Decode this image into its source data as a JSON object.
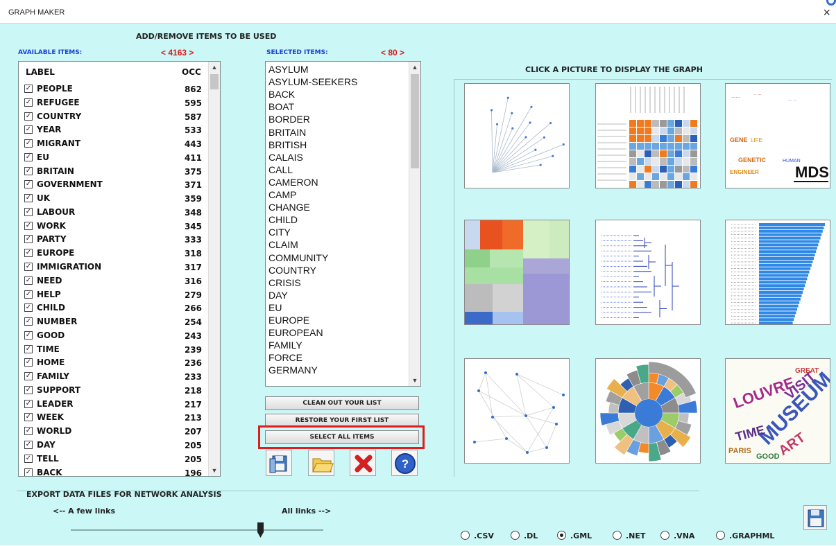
{
  "window": {
    "title": "GRAPH MAKER",
    "close": "×"
  },
  "header": {
    "add_remove": "ADD/REMOVE ITEMS TO BE USED",
    "click_picture": "CLICK A PICTURE TO DISPLAY THE GRAPH"
  },
  "available": {
    "title": "AVAILABLE ITEMS:",
    "count": "< 4163 >",
    "col_label": "LABEL",
    "col_occ": "OCC",
    "items": [
      {
        "label": "PEOPLE",
        "occ": "862"
      },
      {
        "label": "REFUGEE",
        "occ": "595"
      },
      {
        "label": "COUNTRY",
        "occ": "587"
      },
      {
        "label": "YEAR",
        "occ": "533"
      },
      {
        "label": "MIGRANT",
        "occ": "443"
      },
      {
        "label": "EU",
        "occ": "411"
      },
      {
        "label": "BRITAIN",
        "occ": "375"
      },
      {
        "label": "GOVERNMENT",
        "occ": "371"
      },
      {
        "label": "UK",
        "occ": "359"
      },
      {
        "label": "LABOUR",
        "occ": "348"
      },
      {
        "label": "WORK",
        "occ": "345"
      },
      {
        "label": "PARTY",
        "occ": "333"
      },
      {
        "label": "EUROPE",
        "occ": "318"
      },
      {
        "label": "IMMIGRATION",
        "occ": "317"
      },
      {
        "label": "NEED",
        "occ": "316"
      },
      {
        "label": "HELP",
        "occ": "279"
      },
      {
        "label": "CHILD",
        "occ": "266"
      },
      {
        "label": "NUMBER",
        "occ": "254"
      },
      {
        "label": "GOOD",
        "occ": "243"
      },
      {
        "label": "TIME",
        "occ": "239"
      },
      {
        "label": "HOME",
        "occ": "236"
      },
      {
        "label": "FAMILY",
        "occ": "233"
      },
      {
        "label": "SUPPORT",
        "occ": "218"
      },
      {
        "label": "LEADER",
        "occ": "217"
      },
      {
        "label": "WEEK",
        "occ": "213"
      },
      {
        "label": "WORLD",
        "occ": "207"
      },
      {
        "label": "DAY",
        "occ": "205"
      },
      {
        "label": "TELL",
        "occ": "205"
      },
      {
        "label": "BACK",
        "occ": "196"
      }
    ]
  },
  "selected": {
    "title": "SELECTED ITEMS:",
    "count": "< 80 >",
    "items": [
      "ASYLUM",
      "ASYLUM-SEEKERS",
      "BACK",
      "BOAT",
      "BORDER",
      "BRITAIN",
      "BRITISH",
      "CALAIS",
      "CALL",
      "CAMERON",
      "CAMP",
      "CHANGE",
      "CHILD",
      "CITY",
      "CLAIM",
      "COMMUNITY",
      "COUNTRY",
      "CRISIS",
      "DAY",
      "EU",
      "EUROPE",
      "EUROPEAN",
      "FAMILY",
      "FORCE",
      "GERMANY"
    ]
  },
  "buttons": {
    "clean": "CLEAN OUT YOUR LIST",
    "restore": "RESTORE YOUR FIRST LIST",
    "select_all": "SELECT ALL ITEMS"
  },
  "gallery": {
    "mds_label": "MDS",
    "wordcloud_words": [
      "MUSEUM",
      "LOUVRE",
      "VISIT",
      "TIME",
      "ART",
      "PARIS",
      "GOOD",
      "GREAT"
    ],
    "mds_words": [
      "GENE",
      "LIFE",
      "GENETIC",
      "ENGINEER",
      "HUMAN"
    ]
  },
  "export": {
    "title": "EXPORT DATA FILES FOR NETWORK ANALYSIS",
    "few_links": "<-- A few links",
    "all_links": "All links -->",
    "slider_level": 0.75,
    "formats": [
      ".CSV",
      ".DL",
      ".GML",
      ".NET",
      ".VNA",
      ".GRAPHML"
    ],
    "selected_format": ".GML"
  },
  "colors": {
    "background": "#cbf7f7",
    "highlight": "#e41b1b",
    "accent_blue": "#1b40d6"
  }
}
